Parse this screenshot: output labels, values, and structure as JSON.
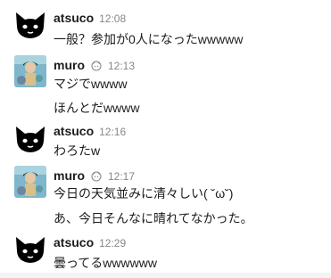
{
  "messages": [
    {
      "user": "atsuco",
      "time": "12:08",
      "avatar": "black-cat-icon",
      "lines": [
        "一般？参加が0人になったwwwww"
      ]
    },
    {
      "user": "muro",
      "time": "12:13",
      "avatar": "photo-avatar",
      "status_icon": "emoji-status-icon",
      "lines": [
        "マジでwwww",
        "ほんとだwwww"
      ]
    },
    {
      "user": "atsuco",
      "time": "12:16",
      "avatar": "black-cat-icon",
      "lines": [
        "わろたw"
      ]
    },
    {
      "user": "muro",
      "time": "12:17",
      "avatar": "photo-avatar",
      "status_icon": "emoji-status-icon",
      "lines": [
        "今日の天気並みに清々しい( ˘ω˘)",
        "あ、今日そんなに晴れてなかった。"
      ]
    },
    {
      "user": "atsuco",
      "time": "12:29",
      "avatar": "black-cat-icon",
      "lines": [
        "曇ってるwwwwww"
      ]
    }
  ],
  "colors": {
    "name": "#1d1c1d",
    "time": "#868686",
    "text": "#1d1c1d",
    "background": "#ffffff"
  }
}
